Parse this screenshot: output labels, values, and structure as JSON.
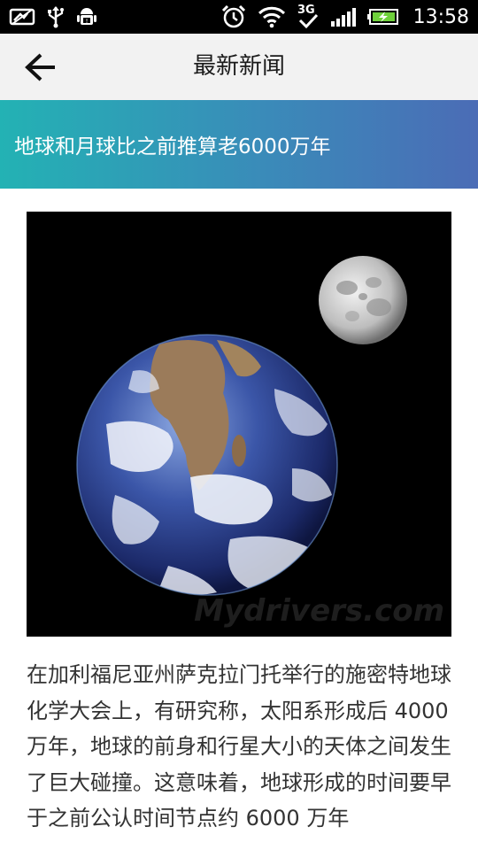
{
  "status_bar": {
    "time": "13:58",
    "network": "3G",
    "icons": [
      "screenshot-icon",
      "usb-icon",
      "android-debug-icon",
      "alarm-icon",
      "wifi-icon",
      "network-3g-icon",
      "signal-icon",
      "battery-charging-icon"
    ],
    "battery_color": "#6fd13b"
  },
  "app_bar": {
    "title": "最新新闻",
    "back_icon": "arrow-left-icon"
  },
  "headline": {
    "text": "地球和月球比之前推算老6000万年",
    "gradient": [
      "#23b2b4",
      "#4b6cb6"
    ]
  },
  "article": {
    "image_watermark": "Mydrivers.com",
    "body": "在加利福尼亚州萨克拉门托举行的施密特地球化学大会上，有研究称，太阳系形成后 4000 万年，地球的前身和行星大小的天体之间发生了巨大碰撞。这意味着，地球形成的时间要早于之前公认时间节点约 6000 万年"
  }
}
